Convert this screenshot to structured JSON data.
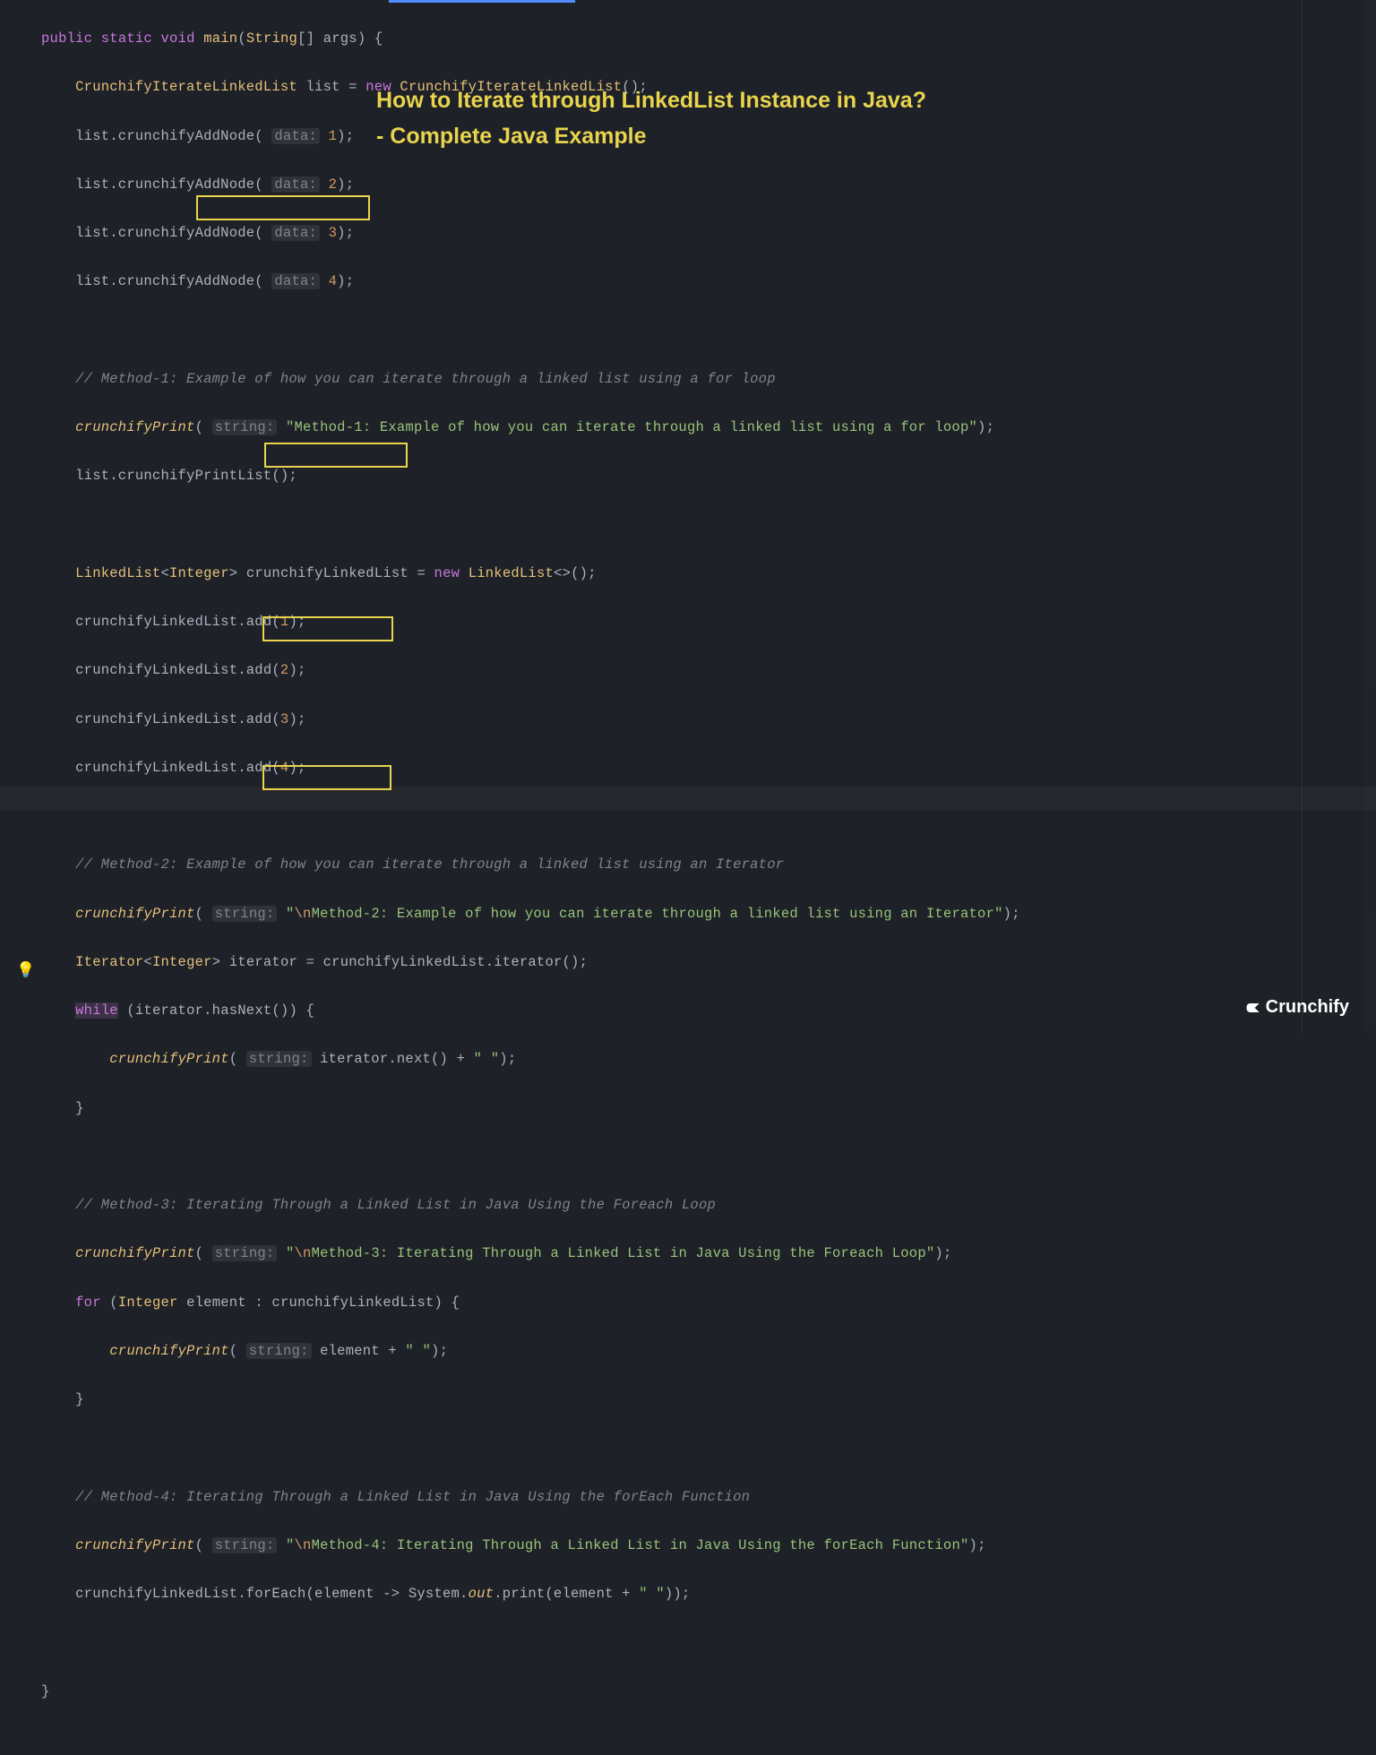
{
  "overlay": {
    "title_line1": "How to Iterate through LinkedList Instance in Java?",
    "title_line2": "- Complete Java Example"
  },
  "brand": {
    "name": "Crunchify"
  },
  "hints": {
    "data": "data:",
    "string": "string:"
  },
  "code": {
    "l1": {
      "kw1": "public",
      "kw2": "static",
      "kw3": "void",
      "fn": "main",
      "sig_open": "(",
      "type": "String",
      "arr": "[] ",
      "arg": "args",
      "sig_close": ") {"
    },
    "l2": {
      "type": "CrunchifyIterateLinkedList",
      "var": "list",
      "eq": " = ",
      "kw": "new",
      "ctor": "CrunchifyIterateLinkedList",
      "tail": "();"
    },
    "l3": {
      "call": "list.crunchifyAddNode(",
      "num": "1",
      "tail": ");"
    },
    "l4": {
      "call": "list.crunchifyAddNode(",
      "num": "2",
      "tail": ");"
    },
    "l5": {
      "call": "list.crunchifyAddNode(",
      "num": "3",
      "tail": ");"
    },
    "l6": {
      "call": "list.crunchifyAddNode(",
      "num": "4",
      "tail": ");"
    },
    "l8": {
      "text": "// Method-1: Example of how you can iterate through a linked list using a for loop"
    },
    "l9": {
      "fn": "crunchifyPrint",
      "open": "(",
      "str": "\"Method-1: Example of how you can iterate through a linked list using a for loop\"",
      "tail": ");"
    },
    "l10": {
      "text": "list.crunchifyPrintList();"
    },
    "l12": {
      "type1": "LinkedList",
      "lt": "<",
      "type2": "Integer",
      "gt": "> ",
      "var": "crunchifyLinkedList",
      "eq": " = ",
      "kw": "new",
      "ctor": "LinkedList",
      "diamond": "<>();"
    },
    "l13": {
      "call": "crunchifyLinkedList.add(",
      "num": "1",
      "tail": ");"
    },
    "l14": {
      "call": "crunchifyLinkedList.add(",
      "num": "2",
      "tail": ");"
    },
    "l15": {
      "call": "crunchifyLinkedList.add(",
      "num": "3",
      "tail": ");"
    },
    "l16": {
      "call": "crunchifyLinkedList.add(",
      "num": "4",
      "tail": ");"
    },
    "l18": {
      "text": "// Method-2: Example of how you can iterate through a linked list using an Iterator"
    },
    "l19": {
      "fn": "crunchifyPrint",
      "open": "(",
      "q1": "\"",
      "esc": "\\n",
      "rest": "Method-2: Example of how you can iterate through a linked list using an Iterator\"",
      "tail": ");"
    },
    "l20": {
      "type1": "Iterator",
      "lt": "<",
      "type2": "Integer",
      "gt": "> ",
      "var": "iterator",
      "eq": " = crunchifyLinkedList.iterator();"
    },
    "l21": {
      "kw": "while",
      "cond": " (iterator.hasNext()) {"
    },
    "l22": {
      "fn": "crunchifyPrint",
      "open": "(",
      "expr": "iterator.next() + ",
      "str": "\" \"",
      "tail": ");"
    },
    "l23": {
      "text": "}"
    },
    "l25": {
      "text": "// Method-3: Iterating Through a Linked List in Java Using the Foreach Loop"
    },
    "l26": {
      "fn": "crunchifyPrint",
      "open": "(",
      "q1": "\"",
      "esc": "\\n",
      "rest": "Method-3: Iterating Through a Linked List in Java Using the Foreach Loop\"",
      "tail": ");"
    },
    "l27": {
      "kw": "for",
      "open": " (",
      "type": "Integer",
      "rest": " element : crunchifyLinkedList) {"
    },
    "l28": {
      "fn": "crunchifyPrint",
      "open": "(",
      "expr": "element + ",
      "str": "\" \"",
      "tail": ");"
    },
    "l29": {
      "text": "}"
    },
    "l31": {
      "text": "// Method-4: Iterating Through a Linked List in Java Using the forEach Function"
    },
    "l32": {
      "fn": "crunchifyPrint",
      "open": "(",
      "q1": "\"",
      "esc": "\\n",
      "rest": "Method-4: Iterating Through a Linked List in Java Using the forEach Function\"",
      "tail": ");"
    },
    "l33": {
      "pre": "crunchifyLinkedList.forEach(element -> System.",
      "out": "out",
      "post": ".print(element + ",
      "str": "\" \"",
      "tail": "));"
    },
    "l35": {
      "text": "}"
    }
  }
}
